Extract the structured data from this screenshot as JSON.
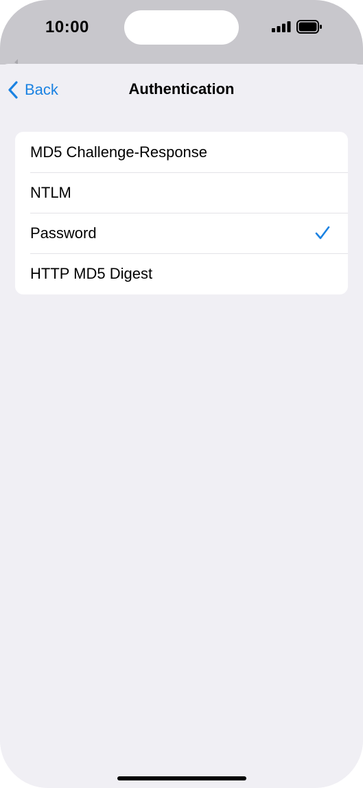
{
  "status_bar": {
    "time": "10:00",
    "signal_icon": "cellular-signal-icon",
    "battery_icon": "battery-icon"
  },
  "nav": {
    "back_label": "Back",
    "back_icon": "chevron-left-icon",
    "title": "Authentication"
  },
  "options": [
    {
      "label": "MD5 Challenge-Response",
      "selected": false
    },
    {
      "label": "NTLM",
      "selected": false
    },
    {
      "label": "Password",
      "selected": true
    },
    {
      "label": "HTTP MD5 Digest",
      "selected": false
    }
  ],
  "colors": {
    "accent": "#1a82e2",
    "background": "#f0eff4",
    "status_bar": "#c8c7cc",
    "list_background": "#ffffff",
    "separator": "#e3e2e7"
  },
  "selected_icon": "checkmark-icon"
}
